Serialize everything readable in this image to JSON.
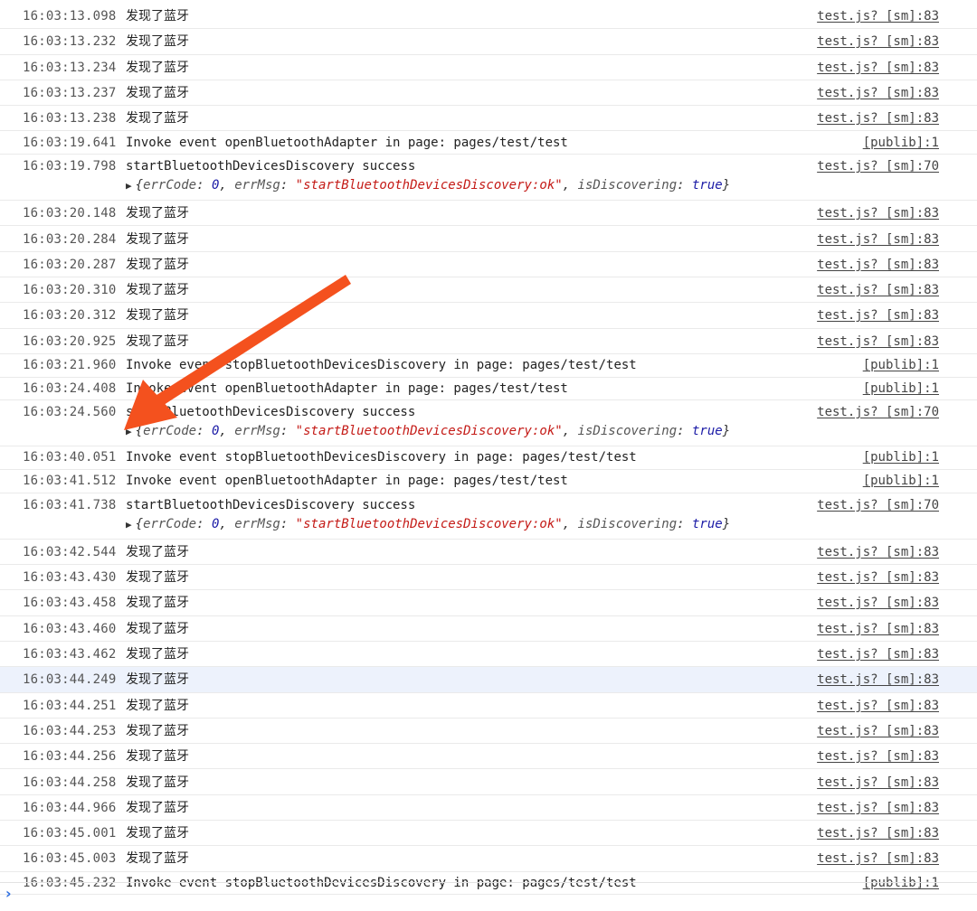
{
  "entries": [
    {
      "type": "log",
      "ts": "16:03:13.098",
      "msg": "发现了蓝牙",
      "src": "test.js? [sm]:83"
    },
    {
      "type": "log",
      "ts": "16:03:13.232",
      "msg": "发现了蓝牙",
      "src": "test.js? [sm]:83"
    },
    {
      "type": "log",
      "ts": "16:03:13.234",
      "msg": "发现了蓝牙",
      "src": "test.js? [sm]:83"
    },
    {
      "type": "log",
      "ts": "16:03:13.237",
      "msg": "发现了蓝牙",
      "src": "test.js? [sm]:83"
    },
    {
      "type": "log",
      "ts": "16:03:13.238",
      "msg": "发现了蓝牙",
      "src": "test.js? [sm]:83"
    },
    {
      "type": "event",
      "ts": "16:03:19.641",
      "msg": "Invoke event openBluetoothAdapter in page: pages/test/test",
      "src": "[publib]:1"
    },
    {
      "type": "object",
      "ts": "16:03:19.798",
      "msg": "startBluetoothDevicesDiscovery success",
      "src": "test.js? [sm]:70",
      "obj": {
        "errCode_key": "errCode",
        "errCode": "0",
        "errMsg_key": "errMsg",
        "errMsg": "\"startBluetoothDevicesDiscovery:ok\"",
        "isDiscovering_key": "isDiscovering",
        "isDiscovering": "true"
      }
    },
    {
      "type": "log",
      "ts": "16:03:20.148",
      "msg": "发现了蓝牙",
      "src": "test.js? [sm]:83"
    },
    {
      "type": "log",
      "ts": "16:03:20.284",
      "msg": "发现了蓝牙",
      "src": "test.js? [sm]:83"
    },
    {
      "type": "log",
      "ts": "16:03:20.287",
      "msg": "发现了蓝牙",
      "src": "test.js? [sm]:83"
    },
    {
      "type": "log",
      "ts": "16:03:20.310",
      "msg": "发现了蓝牙",
      "src": "test.js? [sm]:83"
    },
    {
      "type": "log",
      "ts": "16:03:20.312",
      "msg": "发现了蓝牙",
      "src": "test.js? [sm]:83"
    },
    {
      "type": "log",
      "ts": "16:03:20.925",
      "msg": "发现了蓝牙",
      "src": "test.js? [sm]:83"
    },
    {
      "type": "event",
      "ts": "16:03:21.960",
      "msg": "Invoke event stopBluetoothDevicesDiscovery in page: pages/test/test",
      "src": "[publib]:1"
    },
    {
      "type": "event",
      "ts": "16:03:24.408",
      "msg": "Invoke event openBluetoothAdapter in page: pages/test/test",
      "src": "[publib]:1"
    },
    {
      "type": "object",
      "ts": "16:03:24.560",
      "msg": "startBluetoothDevicesDiscovery success",
      "src": "test.js? [sm]:70",
      "obj": {
        "errCode_key": "errCode",
        "errCode": "0",
        "errMsg_key": "errMsg",
        "errMsg": "\"startBluetoothDevicesDiscovery:ok\"",
        "isDiscovering_key": "isDiscovering",
        "isDiscovering": "true"
      }
    },
    {
      "type": "event",
      "ts": "16:03:40.051",
      "msg": "Invoke event stopBluetoothDevicesDiscovery in page: pages/test/test",
      "src": "[publib]:1"
    },
    {
      "type": "event",
      "ts": "16:03:41.512",
      "msg": "Invoke event openBluetoothAdapter in page: pages/test/test",
      "src": "[publib]:1"
    },
    {
      "type": "object",
      "ts": "16:03:41.738",
      "msg": "startBluetoothDevicesDiscovery success",
      "src": "test.js? [sm]:70",
      "obj": {
        "errCode_key": "errCode",
        "errCode": "0",
        "errMsg_key": "errMsg",
        "errMsg": "\"startBluetoothDevicesDiscovery:ok\"",
        "isDiscovering_key": "isDiscovering",
        "isDiscovering": "true"
      }
    },
    {
      "type": "log",
      "ts": "16:03:42.544",
      "msg": "发现了蓝牙",
      "src": "test.js? [sm]:83"
    },
    {
      "type": "log",
      "ts": "16:03:43.430",
      "msg": "发现了蓝牙",
      "src": "test.js? [sm]:83"
    },
    {
      "type": "log",
      "ts": "16:03:43.458",
      "msg": "发现了蓝牙",
      "src": "test.js? [sm]:83"
    },
    {
      "type": "log",
      "ts": "16:03:43.460",
      "msg": "发现了蓝牙",
      "src": "test.js? [sm]:83"
    },
    {
      "type": "log",
      "ts": "16:03:43.462",
      "msg": "发现了蓝牙",
      "src": "test.js? [sm]:83"
    },
    {
      "type": "log",
      "ts": "16:03:44.249",
      "msg": "发现了蓝牙",
      "src": "test.js? [sm]:83",
      "highlight": true
    },
    {
      "type": "log",
      "ts": "16:03:44.251",
      "msg": "发现了蓝牙",
      "src": "test.js? [sm]:83"
    },
    {
      "type": "log",
      "ts": "16:03:44.253",
      "msg": "发现了蓝牙",
      "src": "test.js? [sm]:83"
    },
    {
      "type": "log",
      "ts": "16:03:44.256",
      "msg": "发现了蓝牙",
      "src": "test.js? [sm]:83"
    },
    {
      "type": "log",
      "ts": "16:03:44.258",
      "msg": "发现了蓝牙",
      "src": "test.js? [sm]:83"
    },
    {
      "type": "log",
      "ts": "16:03:44.966",
      "msg": "发现了蓝牙",
      "src": "test.js? [sm]:83"
    },
    {
      "type": "log",
      "ts": "16:03:45.001",
      "msg": "发现了蓝牙",
      "src": "test.js? [sm]:83"
    },
    {
      "type": "log",
      "ts": "16:03:45.003",
      "msg": "发现了蓝牙",
      "src": "test.js? [sm]:83"
    },
    {
      "type": "event",
      "ts": "16:03:45.232",
      "msg": "Invoke event stopBluetoothDevicesDiscovery in page: pages/test/test",
      "src": "[publib]:1"
    }
  ],
  "prompt": {
    "caret_icon": "chevron-right-icon",
    "value": ""
  },
  "colors": {
    "arrow": "#f4511e",
    "prompt_caret": "#2f6fe0",
    "highlight_row": "#edf2fc",
    "string_value": "#c41a16",
    "number_value": "#1a1aa6"
  }
}
